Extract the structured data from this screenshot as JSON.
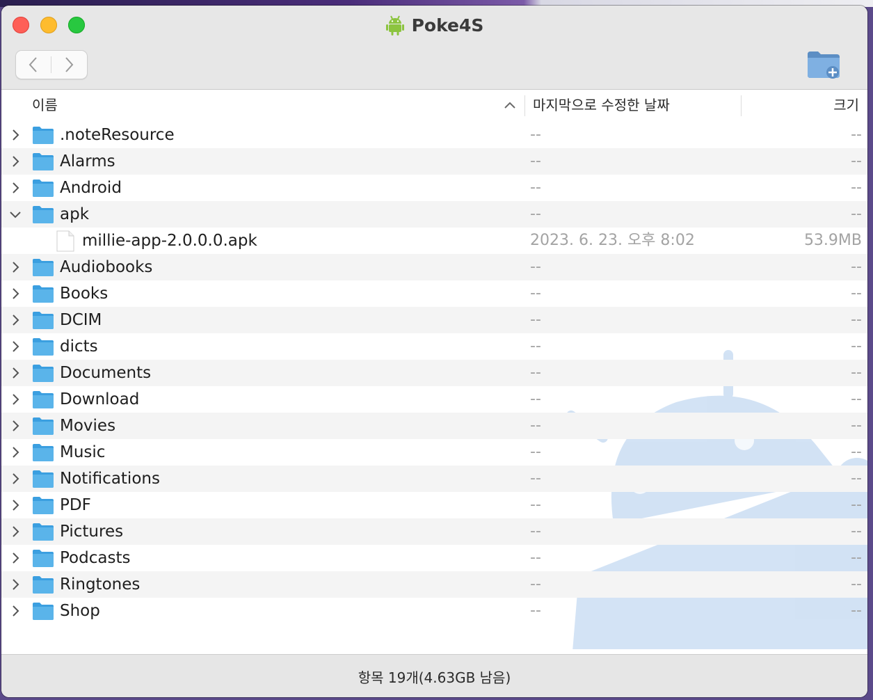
{
  "window": {
    "title": "Poke4S"
  },
  "header": {
    "name": "이름",
    "modified": "마지막으로 수정한 날짜",
    "size": "크기"
  },
  "rows": [
    {
      "type": "folder",
      "expanded": false,
      "name": ".noteResource",
      "date": "--",
      "size": "--"
    },
    {
      "type": "folder",
      "expanded": false,
      "name": "Alarms",
      "date": "--",
      "size": "--"
    },
    {
      "type": "folder",
      "expanded": false,
      "name": "Android",
      "date": "--",
      "size": "--"
    },
    {
      "type": "folder",
      "expanded": true,
      "name": "apk",
      "date": "--",
      "size": "--"
    },
    {
      "type": "file",
      "expanded": false,
      "name": "millie-app-2.0.0.0.apk",
      "date": "2023. 6. 23. 오후 8:02",
      "size": "53.9MB"
    },
    {
      "type": "folder",
      "expanded": false,
      "name": "Audiobooks",
      "date": "--",
      "size": "--"
    },
    {
      "type": "folder",
      "expanded": false,
      "name": "Books",
      "date": "--",
      "size": "--"
    },
    {
      "type": "folder",
      "expanded": false,
      "name": "DCIM",
      "date": "--",
      "size": "--"
    },
    {
      "type": "folder",
      "expanded": false,
      "name": "dicts",
      "date": "--",
      "size": "--"
    },
    {
      "type": "folder",
      "expanded": false,
      "name": "Documents",
      "date": "--",
      "size": "--"
    },
    {
      "type": "folder",
      "expanded": false,
      "name": "Download",
      "date": "--",
      "size": "--"
    },
    {
      "type": "folder",
      "expanded": false,
      "name": "Movies",
      "date": "--",
      "size": "--"
    },
    {
      "type": "folder",
      "expanded": false,
      "name": "Music",
      "date": "--",
      "size": "--"
    },
    {
      "type": "folder",
      "expanded": false,
      "name": "Notifications",
      "date": "--",
      "size": "--"
    },
    {
      "type": "folder",
      "expanded": false,
      "name": "PDF",
      "date": "--",
      "size": "--"
    },
    {
      "type": "folder",
      "expanded": false,
      "name": "Pictures",
      "date": "--",
      "size": "--"
    },
    {
      "type": "folder",
      "expanded": false,
      "name": "Podcasts",
      "date": "--",
      "size": "--"
    },
    {
      "type": "folder",
      "expanded": false,
      "name": "Ringtones",
      "date": "--",
      "size": "--"
    },
    {
      "type": "folder",
      "expanded": false,
      "name": "Shop",
      "date": "--",
      "size": "--"
    }
  ],
  "status": {
    "text": "항목 19개(4.63GB 남음)"
  },
  "icons": {
    "app": "android-icon",
    "back": "chevron-left-icon",
    "forward": "chevron-right-icon",
    "new_folder": "new-folder-icon",
    "sort": "chevron-up-icon",
    "folder": "folder-icon",
    "file": "file-icon",
    "watermark": "android-watermark-icon"
  },
  "colors": {
    "folder": "#5ab4ea",
    "android": "#8cc43f",
    "watermark": "#b5d0ee",
    "close": "#fe5f57",
    "minimize": "#febc2e",
    "zoom": "#28c840"
  }
}
